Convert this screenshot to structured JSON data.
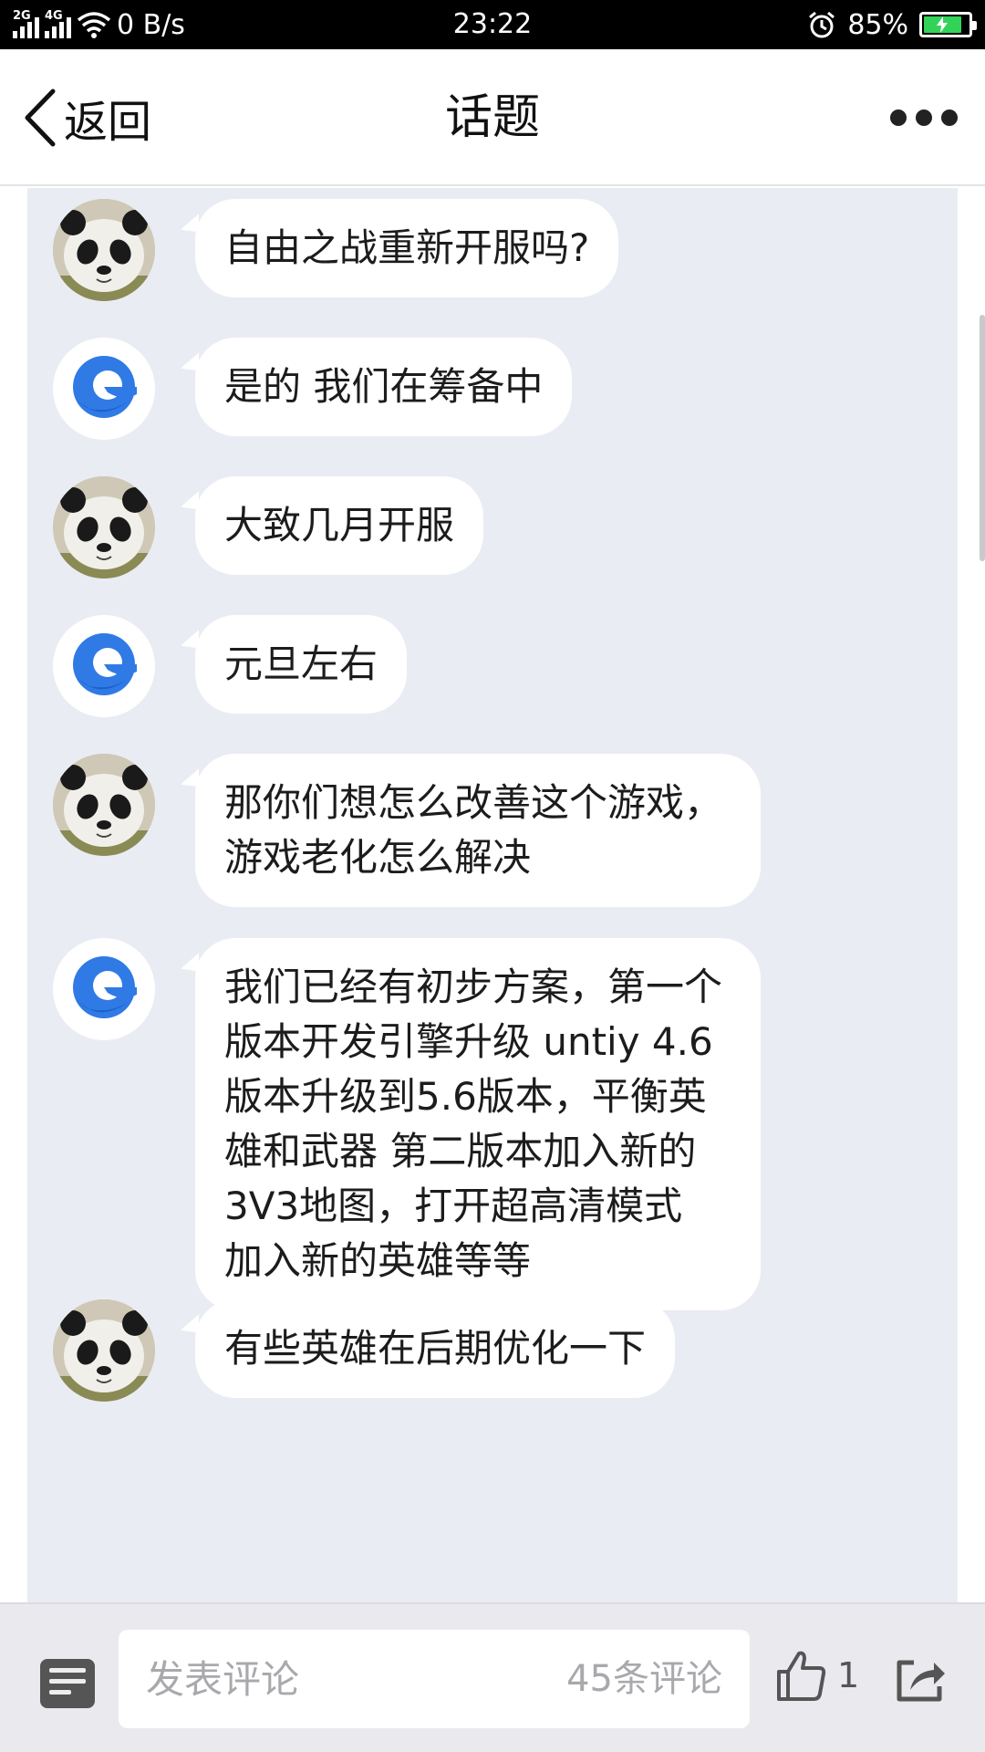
{
  "status_bar": {
    "network_net1": "2G",
    "network_net2": "4G",
    "speed": "0 B/s",
    "time": "23:22",
    "battery": "85%",
    "battery_level": 0.85
  },
  "nav": {
    "back_label": "返回",
    "title": "话题"
  },
  "messages": [
    {
      "sender": "user",
      "text": "自由之战重新开服吗?"
    },
    {
      "sender": "support",
      "text": "是的 我们在筹备中"
    },
    {
      "sender": "user",
      "text": "大致几月开服"
    },
    {
      "sender": "support",
      "text": "元旦左右"
    },
    {
      "sender": "user",
      "text": "那你们想怎么改善这个游戏，游戏老化怎么解决"
    },
    {
      "sender": "support",
      "text": "我们已经有初步方案，第一个版本开发引擎升级 untiy 4.6版本升级到5.6版本，平衡英雄和武器  第二版本加入新的3V3地图，打开超高清模式  加入新的英雄等等"
    },
    {
      "sender": "user",
      "text": "有些英雄在后期优化一下"
    }
  ],
  "bottom_bar": {
    "comment_placeholder": "发表评论",
    "comment_count": "45条评论",
    "like_count": "1"
  }
}
